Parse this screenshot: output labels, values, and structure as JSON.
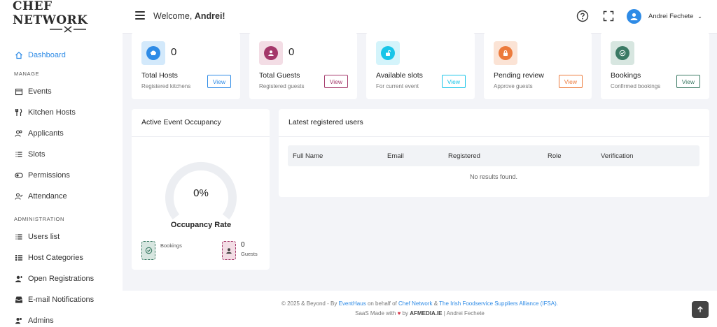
{
  "brand": {
    "name": "CHEF NETWORK",
    "tools": "⨯"
  },
  "sidebar": {
    "dashboard": "Dashboard",
    "section_manage": "MANAGE",
    "manage_items": [
      "Events",
      "Kitchen Hosts",
      "Applicants",
      "Slots",
      "Permissions",
      "Attendance"
    ],
    "section_admin": "ADMINISTRATION",
    "admin_items": [
      "Users list",
      "Host Categories",
      "Open Registrations",
      "E-mail Notifications",
      "Admins"
    ]
  },
  "header": {
    "welcome_prefix": "Welcome,",
    "welcome_name": "Andrei!",
    "user_name": "Andrei Fechete"
  },
  "stats": [
    {
      "title": "Total Hosts",
      "value": "0",
      "subtitle": "Registered kitchens",
      "button": "View",
      "icon": "chef-hat-icon",
      "bg": "#d3e9fb",
      "color": "#2e8be6"
    },
    {
      "title": "Total Guests",
      "value": "0",
      "subtitle": "Registered guests",
      "button": "View",
      "icon": "person-icon",
      "bg": "#f3dde5",
      "color": "#a4386a"
    },
    {
      "title": "Available slots",
      "value": "",
      "subtitle": "For current event",
      "button": "View",
      "icon": "lock-open-icon",
      "bg": "#d4f4fb",
      "color": "#19c5e8"
    },
    {
      "title": "Pending review",
      "value": "",
      "subtitle": "Approve guests",
      "button": "View",
      "icon": "lock-icon",
      "bg": "#fbe3d5",
      "color": "#ec7b3c"
    },
    {
      "title": "Bookings",
      "value": "",
      "subtitle": "Confirmed bookings",
      "button": "View",
      "icon": "check-badge-icon",
      "bg": "#d7e6e0",
      "color": "#3b7a64"
    }
  ],
  "occupancy": {
    "title": "Active Event Occupancy",
    "rate": "0%",
    "rate_value": 0,
    "label": "Occupancy Rate",
    "bookings_label": "Bookings",
    "guests_label": "Guests",
    "guests_value": "0"
  },
  "latest_users": {
    "title": "Latest registered users",
    "columns": [
      "Full Name",
      "Email",
      "Registered",
      "Role",
      "Verification"
    ],
    "empty": "No results found."
  },
  "footer": {
    "copyright": "© 2025 & Beyond - By",
    "eventhaus": "EventHaus",
    "on_behalf": "on behalf of",
    "chef_network": "Chef Network",
    "amp": "&",
    "ifsa": "The Irish Foodservice Suppliers Alliance (IFSA).",
    "saas_prefix": "SaaS Made with",
    "by": "by",
    "afmedia": "AFMEDIA.IE",
    "sep": "|",
    "author": "Andrei Fechete"
  },
  "colors": {
    "accent": "#2e8be6",
    "heart": "#d63447"
  }
}
